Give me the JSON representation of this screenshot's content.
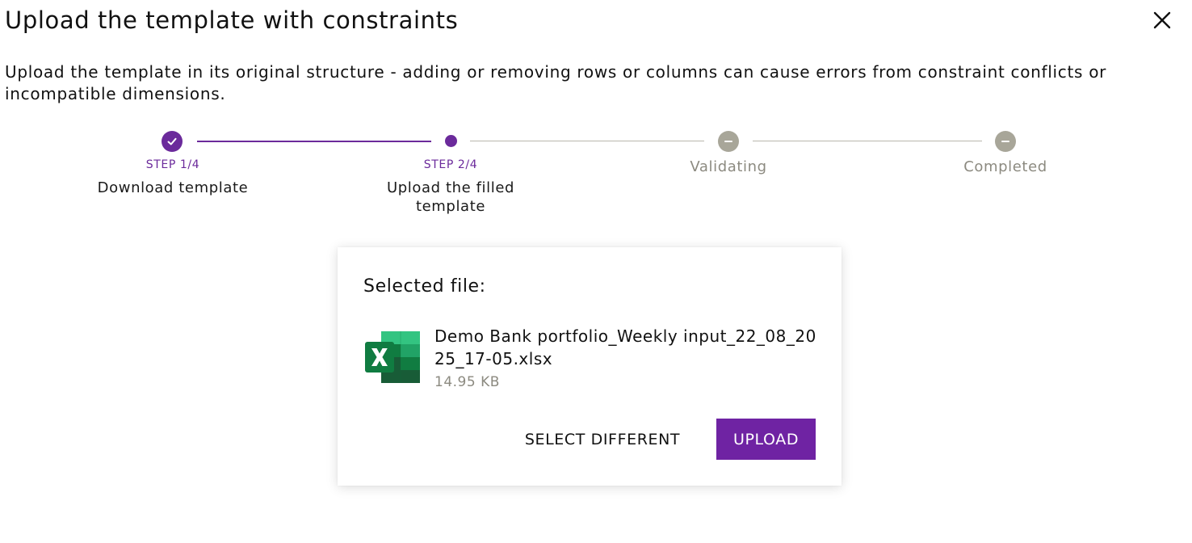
{
  "dialog": {
    "title": "Upload the template with constraints",
    "description": "Upload the template in its original structure - adding or removing rows or columns can cause errors from constraint conflicts or incompatible dimensions."
  },
  "stepper": {
    "steps": [
      {
        "number": "STEP 1/4",
        "label": "Download template",
        "status": "done"
      },
      {
        "number": "STEP 2/4",
        "label": "Upload the filled template",
        "status": "active"
      },
      {
        "number": "",
        "label": "Validating",
        "status": "pending"
      },
      {
        "number": "",
        "label": "Completed",
        "status": "pending"
      }
    ]
  },
  "card": {
    "heading": "Selected file:",
    "file": {
      "icon": "excel-file-icon",
      "name": "Demo Bank portfolio_Weekly input_22_08_2025_17-05.xlsx",
      "size": "14.95 KB"
    },
    "select_different_label": "SELECT DIFFERENT",
    "upload_label": "UPLOAD"
  },
  "colors": {
    "accent": "#6f23a3",
    "pending": "#a8a699",
    "excel_green": "#107c41"
  }
}
